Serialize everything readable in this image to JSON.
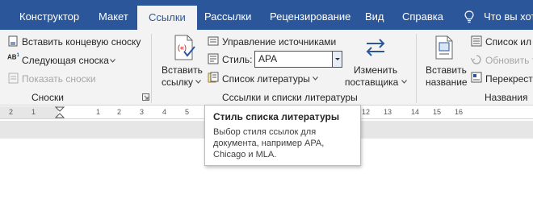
{
  "tabs": [
    {
      "label": "Конструктор"
    },
    {
      "label": "Макет"
    },
    {
      "label": "Ссылки"
    },
    {
      "label": "Рассылки"
    },
    {
      "label": "Рецензирование"
    },
    {
      "label": "Вид"
    },
    {
      "label": "Справка"
    },
    {
      "label": "Что вы хот"
    }
  ],
  "footnotes": {
    "insert_endnote": "Вставить концевую сноску",
    "next_footnote": "Следующая сноска",
    "show_notes": "Показать сноски",
    "group_label": "Сноски"
  },
  "citations": {
    "insert_citation_line1": "Вставить",
    "insert_citation_line2": "ссылку",
    "manage_sources": "Управление источниками",
    "style_label": "Стиль:",
    "style_value": "APA",
    "bibliography": "Список литературы",
    "change_provider_line1": "Изменить",
    "change_provider_line2": "поставщика",
    "group_label": "Сссылки и списки литературы"
  },
  "captions": {
    "insert_caption_line1": "Вставить",
    "insert_caption_line2": "название",
    "list_of_figures": "Список ил",
    "update_table": "Обновить т",
    "cross_reference": "Перекрест",
    "group_label": "Названия"
  },
  "ruler": {
    "numbers": [
      "2",
      "1",
      "1",
      "2",
      "3",
      "4",
      "5",
      "6",
      "7",
      "8",
      "9",
      "10",
      "11",
      "12",
      "13",
      "14",
      "15",
      "16"
    ]
  },
  "tooltip": {
    "title": "Стиль списка литературы",
    "body": "Выбор стиля ссылок для документа, например APA, Chicago и MLA."
  },
  "colors": {
    "brand": "#2b579a",
    "ribbon_bg": "#f3f3f3"
  }
}
